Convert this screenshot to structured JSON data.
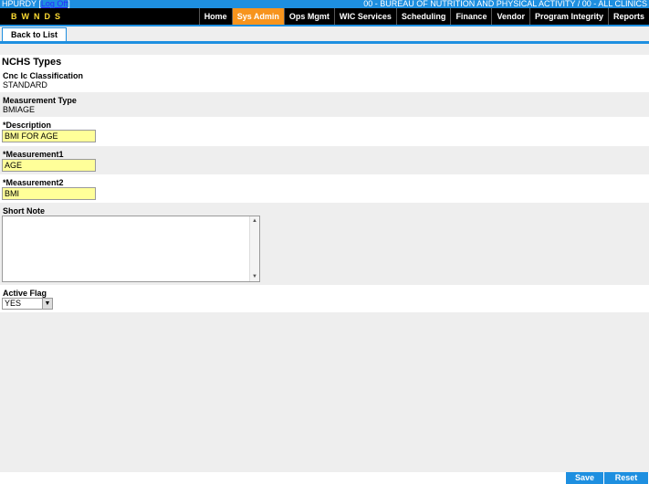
{
  "header": {
    "user": "HPURDY",
    "logoff_label": "Log Off",
    "org": "00 - BUREAU OF NUTRITION AND PHYSICAL ACTIVITY / 00 - ALL CLINICS",
    "logo_text": "BWNDS"
  },
  "nav": {
    "tabs": [
      "Home",
      "Sys Admin",
      "Ops Mgmt",
      "WIC Services",
      "Scheduling",
      "Finance",
      "Vendor",
      "Program Integrity",
      "Reports"
    ],
    "active": "Sys Admin"
  },
  "toolbar": {
    "back_label": "Back to List"
  },
  "page": {
    "title": "NCHS Types"
  },
  "fields": {
    "cnc_label": "Cnc Ic Classification",
    "cnc_value": "STANDARD",
    "mtype_label": "Measurement Type",
    "mtype_value": "BMIAGE",
    "desc_label": "*Description",
    "desc_value": "BMI FOR AGE",
    "m1_label": "*Measurement1",
    "m1_value": "AGE",
    "m2_label": "*Measurement2",
    "m2_value": "BMI",
    "note_label": "Short Note",
    "note_value": "",
    "active_label": "Active Flag",
    "active_value": "YES"
  },
  "actions": {
    "save_label": "Save",
    "reset_label": "Reset"
  },
  "colors": {
    "accent": "#1e8fe0",
    "active_tab": "#f7941d",
    "required_field": "#ffff99"
  }
}
